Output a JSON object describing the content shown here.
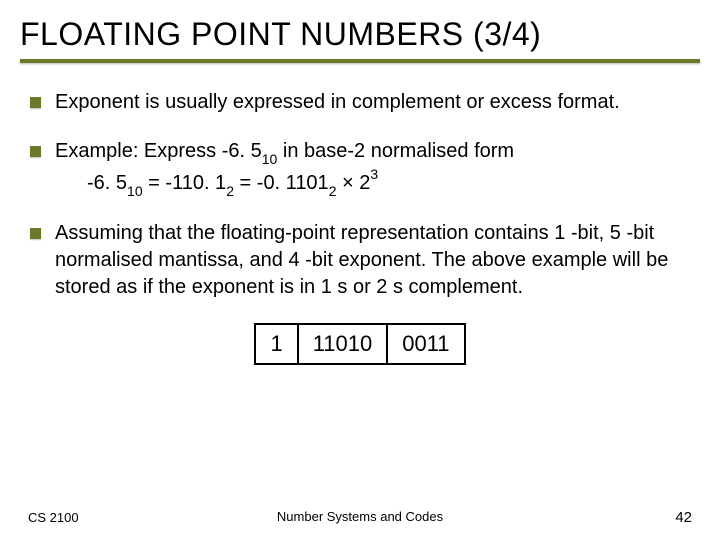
{
  "title": "FLOATING POINT NUMBERS (3/4)",
  "bullets": {
    "b0": "Exponent is usually expressed in complement or excess format.",
    "b1_line1_pre": "Example: Express -6. 5",
    "b1_line1_sub1": "10",
    "b1_line1_post": " in base-2 normalised form",
    "b1_line2_a": "-6. 5",
    "b1_line2_sub1": "10",
    "b1_line2_b": " = -110. 1",
    "b1_line2_sub2": "2",
    "b1_line2_c": " = -0. 1101",
    "b1_line2_sub3": "2",
    "b1_line2_d": " × 2",
    "b1_line2_sup": "3",
    "b2": "Assuming that the floating-point representation contains 1 -bit, 5 -bit normalised mantissa, and 4 -bit exponent. The above example will be stored as if the exponent is in 1 s or 2 s complement."
  },
  "bit_table": {
    "sign": "1",
    "mantissa": "11010",
    "exponent": "0011"
  },
  "footer": {
    "left": "CS 2100",
    "center": "Number Systems and Codes",
    "right": "42"
  }
}
